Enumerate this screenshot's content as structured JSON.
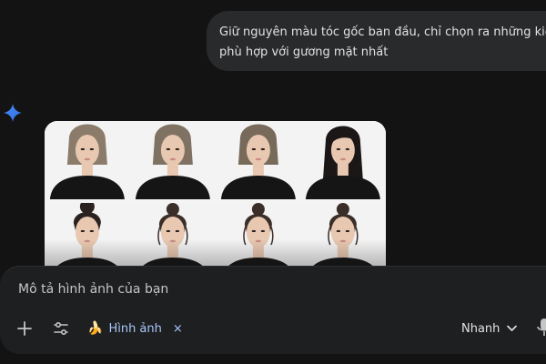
{
  "conversation": {
    "user_message": {
      "line1": "Giữ nguyên màu tóc gốc ban đầu, chỉ chọn ra những kiểu tóc",
      "line2": "phù hợp với gương mặt nhất"
    },
    "assistant_icon": "sparkle-icon",
    "image_grid": {
      "rows": 2,
      "columns": 4,
      "cells": [
        {
          "style": "bob-bangs",
          "hair": "#8b7b6b"
        },
        {
          "style": "bob-bangs",
          "hair": "#7f7263"
        },
        {
          "style": "bob-bangs",
          "hair": "#776a5b"
        },
        {
          "style": "long-straight",
          "hair": "#1b1717"
        },
        {
          "style": "high-bun",
          "hair": "#2a2220"
        },
        {
          "style": "messy-bun",
          "hair": "#3a2e28"
        },
        {
          "style": "messy-bun",
          "hair": "#3a2e28"
        },
        {
          "style": "messy-bun",
          "hair": "#3a2e28"
        }
      ]
    }
  },
  "composer": {
    "placeholder": "Mô tả hình ảnh của bạn",
    "add_icon": "plus-icon",
    "tools_icon": "sliders-icon",
    "chip": {
      "emoji": "🍌",
      "label": "Hình ảnh",
      "close": "×"
    },
    "model": {
      "label": "Nhanh",
      "icon": "chevron-down-icon"
    },
    "mic_icon": "microphone-icon"
  },
  "colors": {
    "background": "#131314",
    "bubble": "#282a2c",
    "composer": "#1e1f20",
    "accent": "#a8c7fa",
    "sparkle": "#4285f4"
  }
}
